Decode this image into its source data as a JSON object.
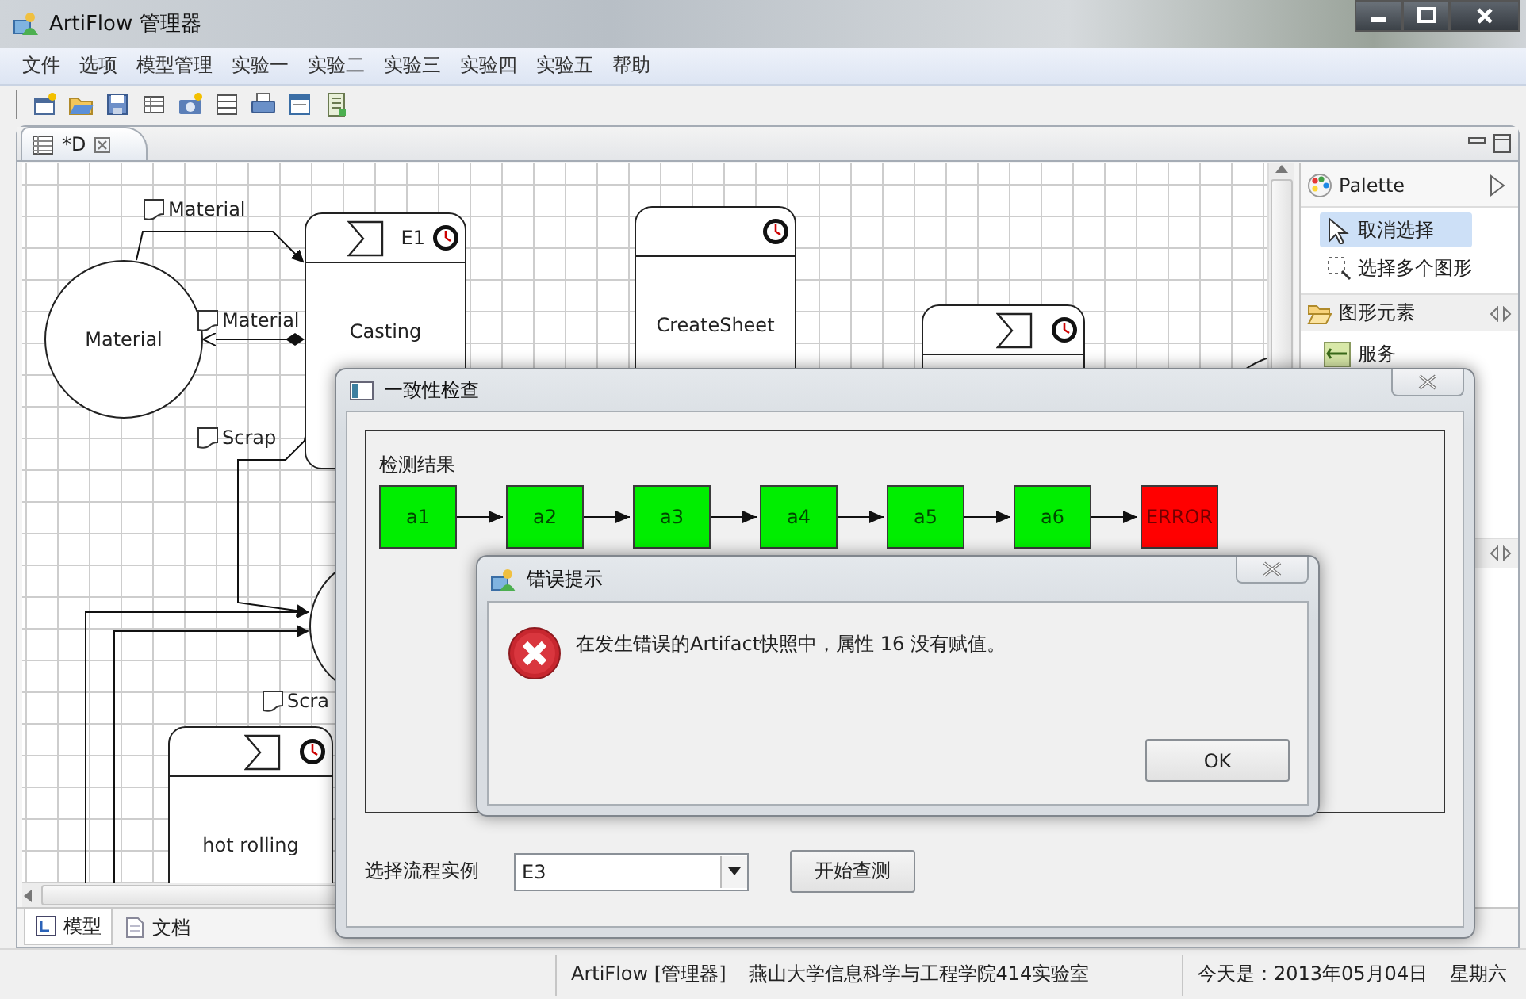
{
  "window": {
    "title": "ArtiFlow 管理器"
  },
  "menu": [
    "文件",
    "选项",
    "模型管理",
    "实验一",
    "实验二",
    "实验三",
    "实验四",
    "实验五",
    "帮助"
  ],
  "editor_tab": {
    "label": "*D"
  },
  "canvas": {
    "nodes": [
      {
        "kind": "circle",
        "label": "Material"
      },
      {
        "kind": "task",
        "label": "Casting",
        "tag": "E1",
        "flag": true
      },
      {
        "kind": "task",
        "label": "CreateSheet",
        "flag": false
      },
      {
        "kind": "task",
        "flag": true
      },
      {
        "kind": "circle"
      },
      {
        "kind": "circle"
      },
      {
        "kind": "task",
        "label": "hot rolling",
        "flag": true
      }
    ],
    "notes": [
      "Material",
      "Material",
      "Scrap",
      "Scra"
    ]
  },
  "bottom_tabs": [
    {
      "label": "模型",
      "selected": true
    },
    {
      "label": "文档",
      "selected": false
    }
  ],
  "palette": {
    "title": "Palette",
    "tools": [
      {
        "label": "取消选择",
        "selected": true
      },
      {
        "label": "选择多个图形",
        "selected": false
      }
    ],
    "drawers": [
      {
        "label": "图形元素",
        "expanded": true,
        "items": [
          "服务"
        ]
      }
    ]
  },
  "status_bar": {
    "app": "ArtiFlow [管理器]",
    "lab": "燕山大学信息科学与工程学院414实验室",
    "date": "今天是：2013年05月04日",
    "weekday": "星期六"
  },
  "consistency_dialog": {
    "title": "一致性检查",
    "result_label": "检测结果",
    "steps": [
      {
        "label": "a1",
        "color": "#00ee00"
      },
      {
        "label": "a2",
        "color": "#00ee00"
      },
      {
        "label": "a3",
        "color": "#00ee00"
      },
      {
        "label": "a4",
        "color": "#00ee00"
      },
      {
        "label": "a5",
        "color": "#00ee00"
      },
      {
        "label": "a6",
        "color": "#00ee00"
      },
      {
        "label": "ERROR",
        "color": "#ff0000"
      }
    ],
    "instance_label": "选择流程实例",
    "instance_value": "E3",
    "start_button": "开始查测"
  },
  "error_dialog": {
    "title": "错误提示",
    "message": "在发生错误的Artifact快照中，属性 16 没有赋值。",
    "button": "OK"
  }
}
